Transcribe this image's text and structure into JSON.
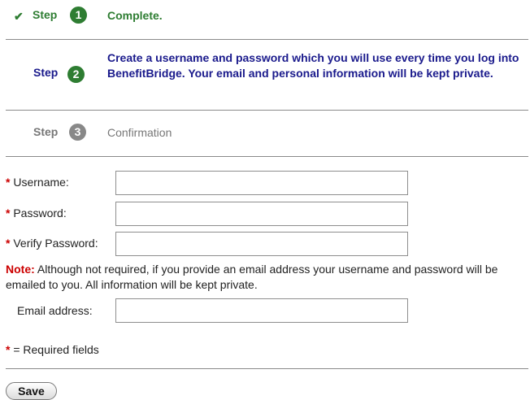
{
  "steps": [
    {
      "label": "Step",
      "number": "1",
      "text": "Complete.",
      "state": "complete"
    },
    {
      "label": "Step",
      "number": "2",
      "text": "Create a username and password which you will use every time you log into BenefitBridge. Your email and personal information will be kept private.",
      "state": "current"
    },
    {
      "label": "Step",
      "number": "3",
      "text": "Confirmation",
      "state": "pending"
    }
  ],
  "form": {
    "required_marker": "*",
    "username": {
      "label": "Username:",
      "value": ""
    },
    "password": {
      "label": "Password:",
      "value": ""
    },
    "verify_password": {
      "label": "Verify Password:",
      "value": ""
    },
    "note_label": "Note:",
    "note_text": "Although not required, if you provide an email address your username and password will be emailed to you. All information will be kept private.",
    "email": {
      "label": "Email address:",
      "value": ""
    },
    "required_legend": "= Required fields",
    "save_label": "Save"
  },
  "colors": {
    "complete_green": "#2e7d32",
    "current_blue": "#1a1a8c",
    "pending_gray": "#777777",
    "required_red": "#cc0000"
  },
  "icons": {
    "complete_marker": "check-icon"
  }
}
